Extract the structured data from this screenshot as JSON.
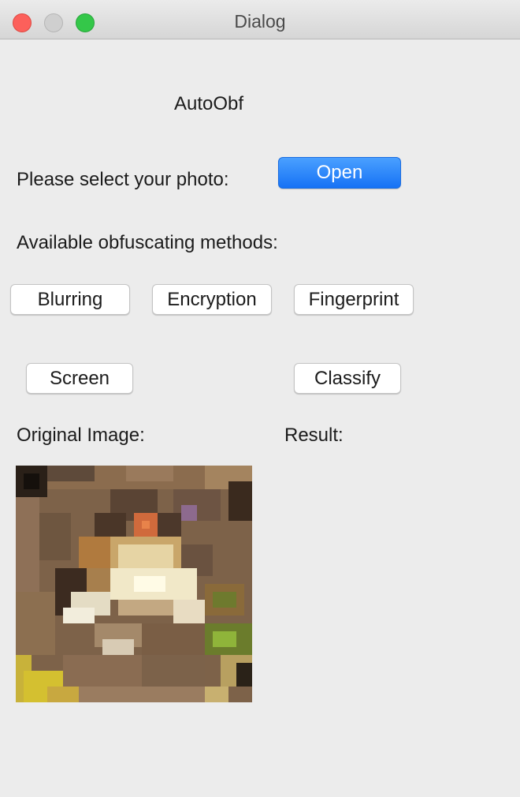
{
  "window": {
    "title": "Dialog"
  },
  "app": {
    "title": "AutoObf"
  },
  "select_photo": {
    "label": "Please select your photo:",
    "open_button": "Open"
  },
  "methods": {
    "label": "Available obfuscating methods:",
    "buttons": [
      "Blurring",
      "Encryption",
      "Fingerprint"
    ]
  },
  "actions": {
    "screen_button": "Screen",
    "classify_button": "Classify"
  },
  "panels": {
    "original_label": "Original Image:",
    "result_label": "Result:"
  },
  "colors": {
    "accent": "#1672f5",
    "background": "#ececec"
  }
}
